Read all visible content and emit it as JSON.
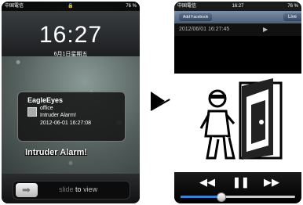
{
  "lock": {
    "status": {
      "carrier": "中国電信",
      "wifi": "wifi-icon",
      "lock_icon": "padlock-icon",
      "battery": "76 %"
    },
    "clock": "16:27",
    "date": "6月1日星期五",
    "notification": {
      "app": "EagleEyes",
      "line1": "office",
      "line2": "Intruder Alarm!",
      "line3": "2012-06-01 16:27:08"
    },
    "alarm_text": "Intruder Alarm!",
    "slider": {
      "slide": "slide",
      "to": "to",
      "view": "view"
    }
  },
  "player": {
    "status": {
      "carrier": "中国電信",
      "time": "16:27",
      "battery": "76 %"
    },
    "back_label": "Add Facebook",
    "live_label": "Live",
    "timestamp": "2012/06/01 16:27:45",
    "progress": 0.35
  }
}
